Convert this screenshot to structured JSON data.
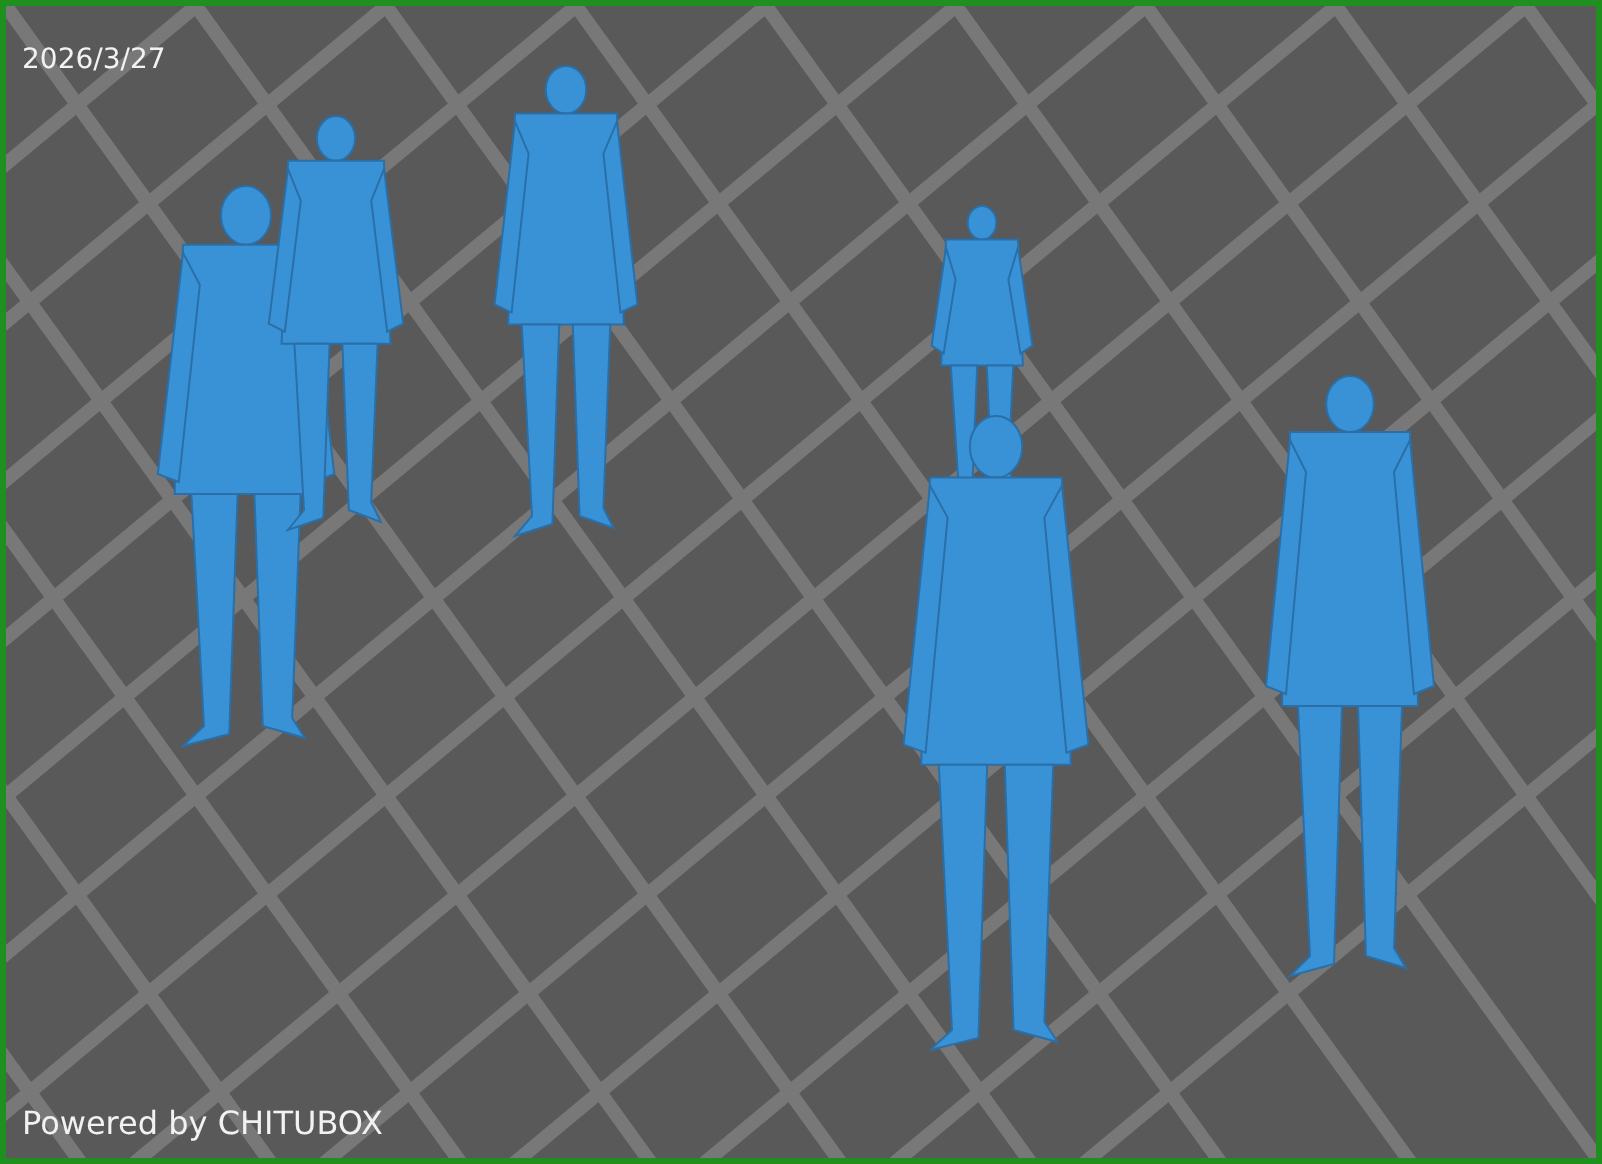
{
  "viewport": {
    "date": "2026/3/27",
    "footer": "Powered by CHITUBOX"
  }
}
